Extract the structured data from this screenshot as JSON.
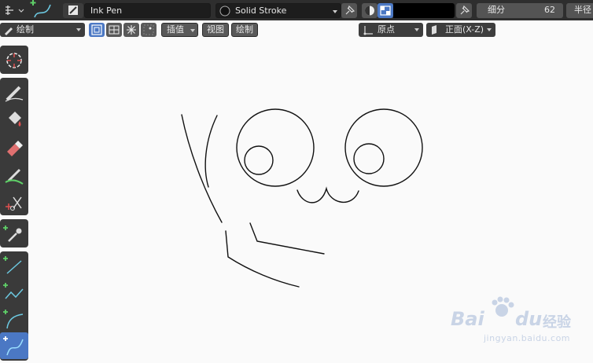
{
  "header": {
    "brush_name": "Ink Pen",
    "stroke_material": "Solid Stroke",
    "subdivide_label": "细分",
    "subdivide_value": "62",
    "truncated_label": "半径"
  },
  "toolbar2": {
    "mode": "绘制",
    "interp_label": "插值",
    "view_label": "视图",
    "draw_label": "绘制",
    "origin_label": "原点",
    "plane_label": "正面(X-Z)"
  },
  "tools": [
    {
      "name": "cursor-tool"
    },
    {
      "name": "draw-tool"
    },
    {
      "name": "fill-tool"
    },
    {
      "name": "erase-tool"
    },
    {
      "name": "tint-tool"
    },
    {
      "name": "cutter-tool"
    },
    {
      "name": "eyedropper-tool"
    },
    {
      "name": "line-tool"
    },
    {
      "name": "polyline-tool"
    },
    {
      "name": "arc-tool"
    },
    {
      "name": "curve-tool",
      "active": true
    }
  ],
  "watermark": {
    "brand": "Bai",
    "brand2": "du",
    "jy": "经验",
    "url": "jingyan.baidu.com"
  },
  "colors": {
    "header_bg": "#2e2e2e",
    "accent_blue": "#4b78c4",
    "canvas_bg": "#fafafa",
    "stroke": "#111111"
  }
}
